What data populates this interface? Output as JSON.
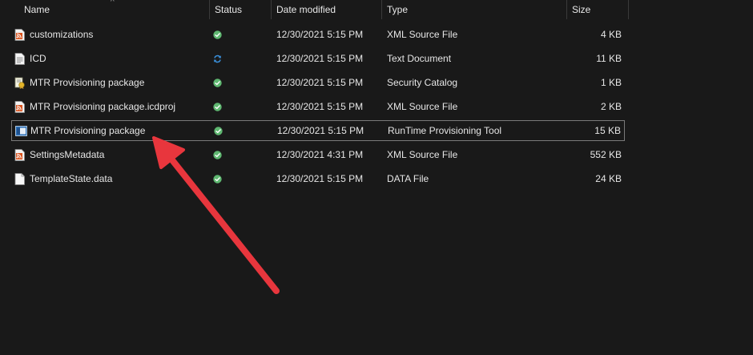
{
  "columns": {
    "name": "Name",
    "status": "Status",
    "date": "Date modified",
    "type": "Type",
    "size": "Size"
  },
  "files": [
    {
      "name": "customizations",
      "icon": "xml-file-icon",
      "status": "synced",
      "date": "12/30/2021 5:15 PM",
      "type": "XML Source File",
      "size": "4 KB"
    },
    {
      "name": "ICD",
      "icon": "text-file-icon",
      "status": "syncing",
      "date": "12/30/2021 5:15 PM",
      "type": "Text Document",
      "size": "11 KB"
    },
    {
      "name": "MTR Provisioning package",
      "icon": "security-catalog-icon",
      "status": "synced",
      "date": "12/30/2021 5:15 PM",
      "type": "Security Catalog",
      "size": "1 KB"
    },
    {
      "name": "MTR Provisioning package.icdproj",
      "icon": "xml-file-icon",
      "status": "synced",
      "date": "12/30/2021 5:15 PM",
      "type": "XML Source File",
      "size": "2 KB"
    },
    {
      "name": "MTR Provisioning package",
      "icon": "provisioning-package-icon",
      "status": "synced",
      "date": "12/30/2021 5:15 PM",
      "type": "RunTime Provisioning Tool",
      "size": "15 KB",
      "selected": true
    },
    {
      "name": "SettingsMetadata",
      "icon": "xml-file-icon",
      "status": "synced",
      "date": "12/30/2021 4:31 PM",
      "type": "XML Source File",
      "size": "552 KB"
    },
    {
      "name": "TemplateState.data",
      "icon": "blank-file-icon",
      "status": "synced",
      "date": "12/30/2021 5:15 PM",
      "type": "DATA File",
      "size": "24 KB"
    }
  ],
  "colors": {
    "background": "#191919",
    "synced": "#5fb871",
    "syncing": "#3a8fd9",
    "annotation_arrow": "#e8363d",
    "selection_border": "#7a7a7a"
  }
}
